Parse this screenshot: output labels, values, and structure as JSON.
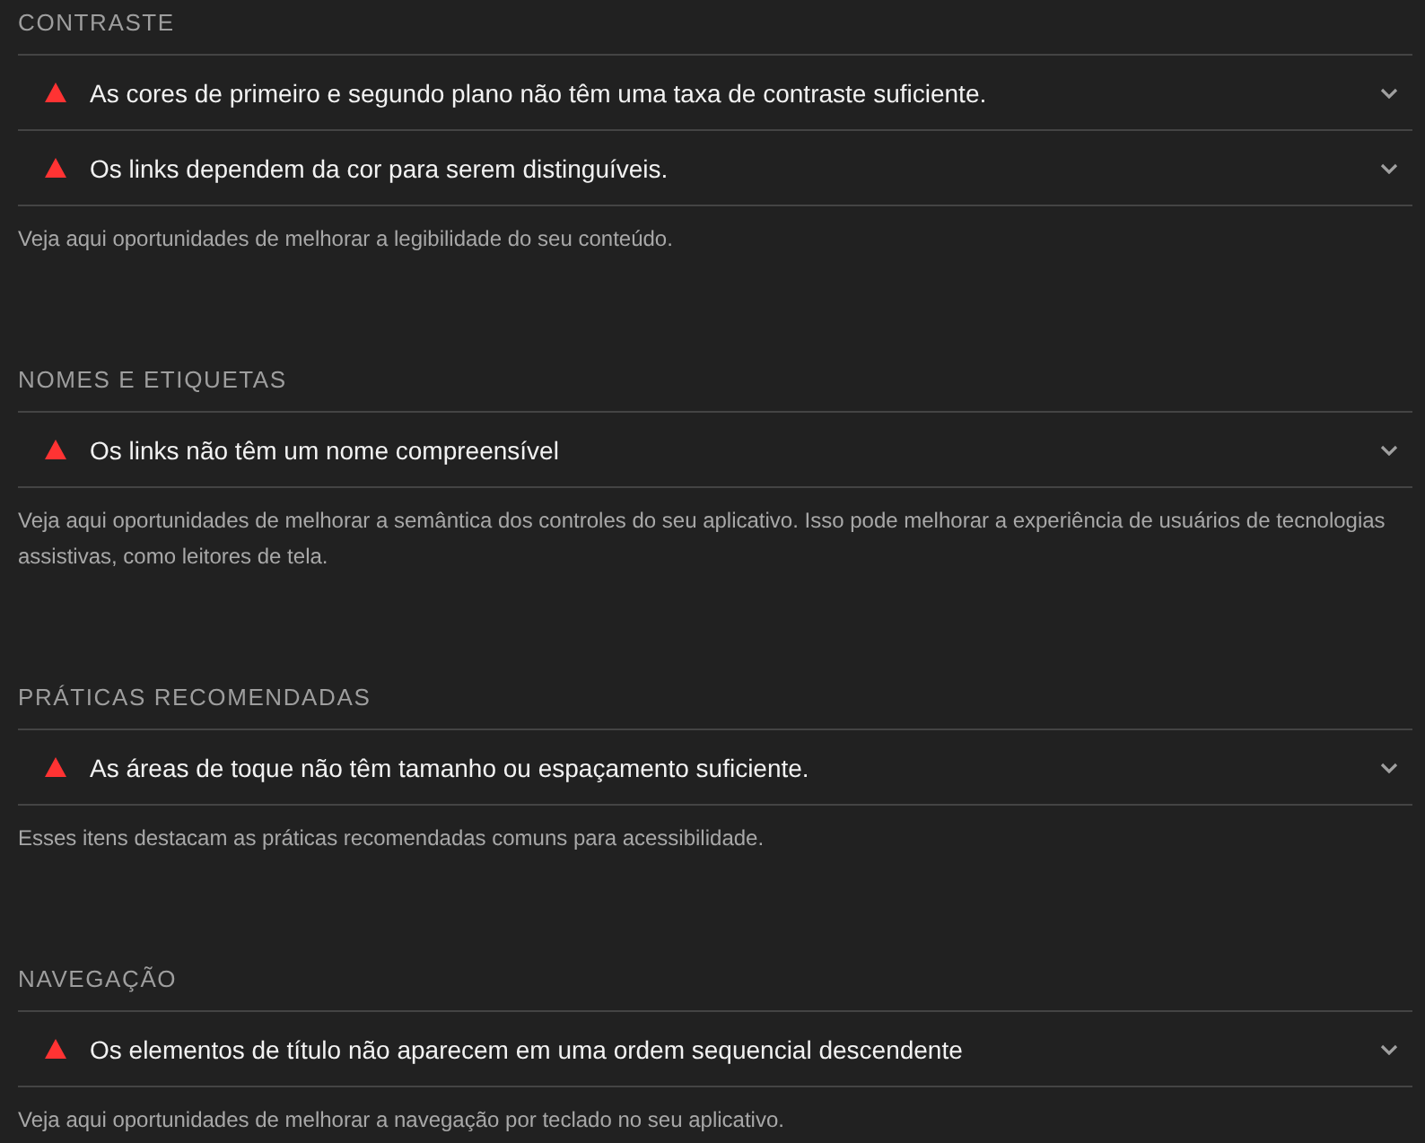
{
  "groups": [
    {
      "title": "CONTRASTE",
      "audits": [
        {
          "text": "As cores de primeiro e segundo plano não têm uma taxa de contraste suficiente.",
          "kind": "fail",
          "expanded": false
        },
        {
          "text": "Os links dependem da cor para serem distinguíveis.",
          "kind": "fail",
          "expanded": false
        }
      ],
      "description": "Veja aqui oportunidades de melhorar a legibilidade do seu conteúdo."
    },
    {
      "title": "NOMES E ETIQUETAS",
      "audits": [
        {
          "text": "Os links não têm um nome compreensível",
          "kind": "fail",
          "expanded": false
        }
      ],
      "description": "Veja aqui oportunidades de melhorar a semântica dos controles do seu aplicativo. Isso pode melhorar a experiência de usuários de tecnologias assistivas, como leitores de tela."
    },
    {
      "title": "PRÁTICAS RECOMENDADAS",
      "audits": [
        {
          "text": "As áreas de toque não têm tamanho ou espaçamento suficiente.",
          "kind": "fail",
          "expanded": false
        }
      ],
      "description": "Esses itens destacam as práticas recomendadas comuns para acessibilidade."
    },
    {
      "title": "NAVEGAÇÃO",
      "audits": [
        {
          "text": "Os elementos de título não aparecem em uma ordem sequencial descendente",
          "kind": "fail",
          "expanded": false
        }
      ],
      "description": "Veja aqui oportunidades de melhorar a navegação por teclado no seu aplicativo."
    }
  ]
}
